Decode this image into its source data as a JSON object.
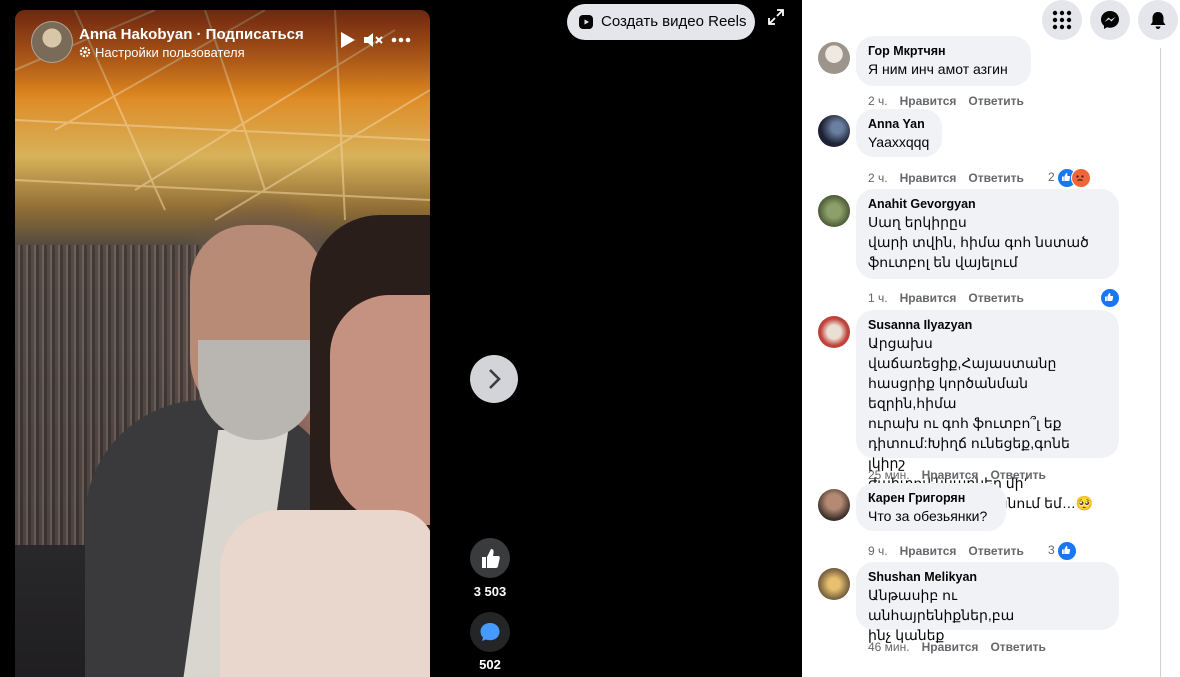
{
  "video": {
    "author": "Anna Hakobyan · Подписаться",
    "privacy_label": "Настройки пользователя"
  },
  "toolbar": {
    "create_reels_label": "Создать видео Reels"
  },
  "actions": {
    "likes_count": "3 503",
    "comments_count": "502"
  },
  "comments": [
    {
      "name": "Гор Мкртчян",
      "text": "Я ним инч амот азгин",
      "time": "2 ч.",
      "like_label": "Нравится",
      "reply_label": "Ответить",
      "reactions_count": ""
    },
    {
      "name": "Anna Yan",
      "text": "Yaaxxqqq",
      "time": "2 ч.",
      "like_label": "Нравится",
      "reply_label": "Ответить",
      "reactions_count": "2"
    },
    {
      "name": "Anahit Gevorgyan",
      "text": "Սաղ երկիրըս\nվարի տվին, հիմա գոհ նստած\nֆուտբոլ են վայելում",
      "time": "1 ч.",
      "like_label": "Нравится",
      "reply_label": "Ответить",
      "reactions_count": ""
    },
    {
      "name": "Susanna Ilyazyan",
      "text": "Արցախս վաճառեցիք,Հայաստանը\nհասցրիք կործանման եզրին,հիմա\nուրախ ու գոհ ֆուտբո՞լ եք\nդիտում:Խիղճ ունեցեք,գոնե լկիրշ\nժպիտով նկարներ մի՚\nտեղադրեք:Խենթանում եմ…🥺",
      "time": "25 мин.",
      "like_label": "Нравится",
      "reply_label": "Ответить",
      "reactions_count": ""
    },
    {
      "name": "Карен Григорян",
      "text": "Что за обезьянки?",
      "time": "9 ч.",
      "like_label": "Нравится",
      "reply_label": "Ответить",
      "reactions_count": "3"
    },
    {
      "name": "Shushan Melikyan",
      "text": "Անթասիբ ու անհայրենիքներ,բա\nինչ կանեք",
      "time": "46 мин.",
      "like_label": "Нравится",
      "reply_label": "Ответить",
      "reactions_count": ""
    }
  ]
}
